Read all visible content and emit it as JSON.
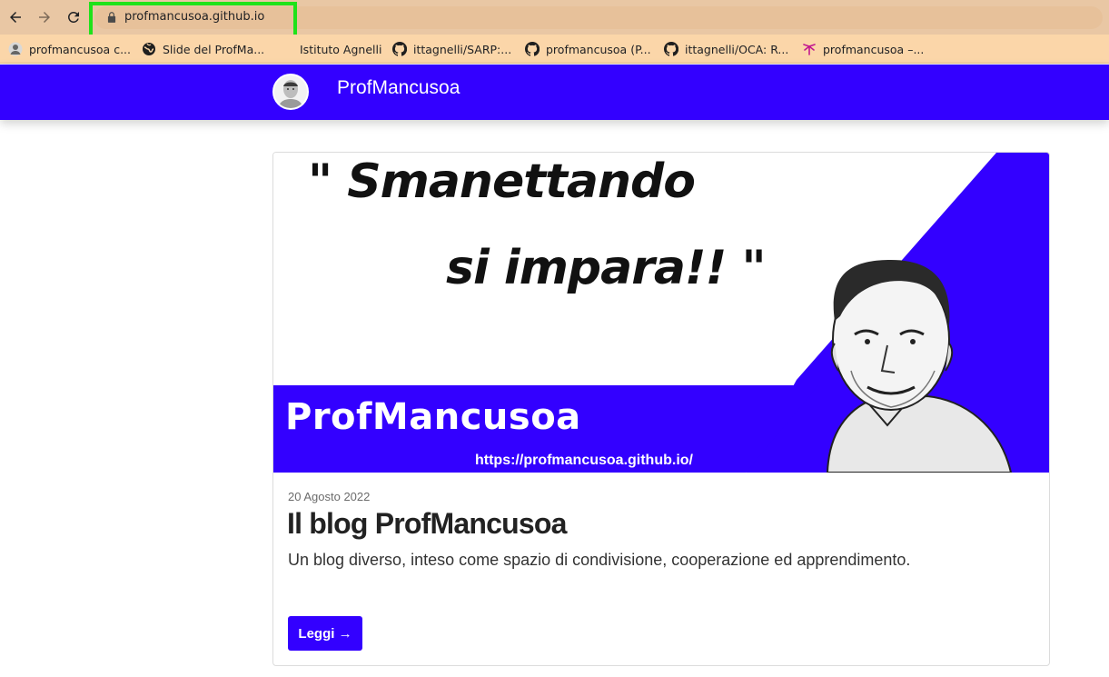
{
  "browser": {
    "url": "profmancusoa.github.io",
    "icons": {
      "back": "arrow-left-icon",
      "forward": "arrow-right-icon",
      "reload": "reload-icon",
      "lock": "lock-icon"
    },
    "bookmarks": [
      {
        "label": "profmancusoa c...",
        "icon": "avatar-favicon"
      },
      {
        "label": "Slide del ProfMa...",
        "icon": "globe-icon"
      },
      {
        "label": "Istituto Agnelli",
        "icon": ""
      },
      {
        "label": "ittagnelli/SARP:...",
        "icon": "github-icon"
      },
      {
        "label": "profmancusoa (P...",
        "icon": "github-icon"
      },
      {
        "label": "ittagnelli/OCA: R...",
        "icon": "github-icon"
      },
      {
        "label": "profmancusoa –...",
        "icon": "pink-favicon"
      }
    ]
  },
  "site": {
    "title": "ProfMancusoa",
    "brand_color": "#3300ff"
  },
  "post": {
    "hero": {
      "quote_line1": "\" Smanettando",
      "quote_line2": "si impara!! \"",
      "brand": "ProfMancusoa",
      "url": "https://profmancusoa.github.io/"
    },
    "date": "20 Agosto 2022",
    "title": "Il blog ProfMancusoa",
    "excerpt": "Un blog diverso, inteso come spazio di condivisione, cooperazione ed apprendimento.",
    "read_more": "Leggi →"
  }
}
